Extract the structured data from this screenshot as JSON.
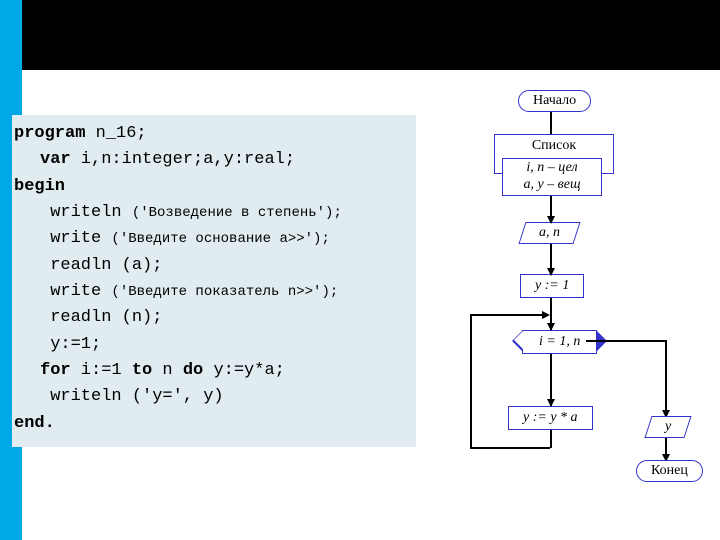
{
  "code": {
    "l1a": "program",
    "l1b": " n_16;",
    "l2a": "var",
    "l2b": " i,n:integer;a,y:real;",
    "l3": "begin",
    "l4a": " writeln ",
    "l4b": "('Возведение в степень');",
    "l5a": " write ",
    "l5b": "('Введите основание a>>');",
    "l6": " readln (a);",
    "l7a": " write ",
    "l7b": "('Введите показатель n>>');",
    "l8": " readln (n);",
    "l9": " y:=1;",
    "l10a": "for",
    "l10b": " i:=1 ",
    "l10c": "to",
    "l10d": " n ",
    "l10e": "do",
    "l10f": " y:=y*a;",
    "l11": " writeln ('y=', y)",
    "l12": "end."
  },
  "flow": {
    "start": "Начало",
    "list_title": "Список данных",
    "list_desc_l1": "i, n – цел",
    "list_desc_l2": "a, y – вещ",
    "input": "a, n",
    "init": "y := 1",
    "loop": "i = 1, n",
    "body": "y := y * a",
    "output": "y",
    "end": "Конец"
  }
}
